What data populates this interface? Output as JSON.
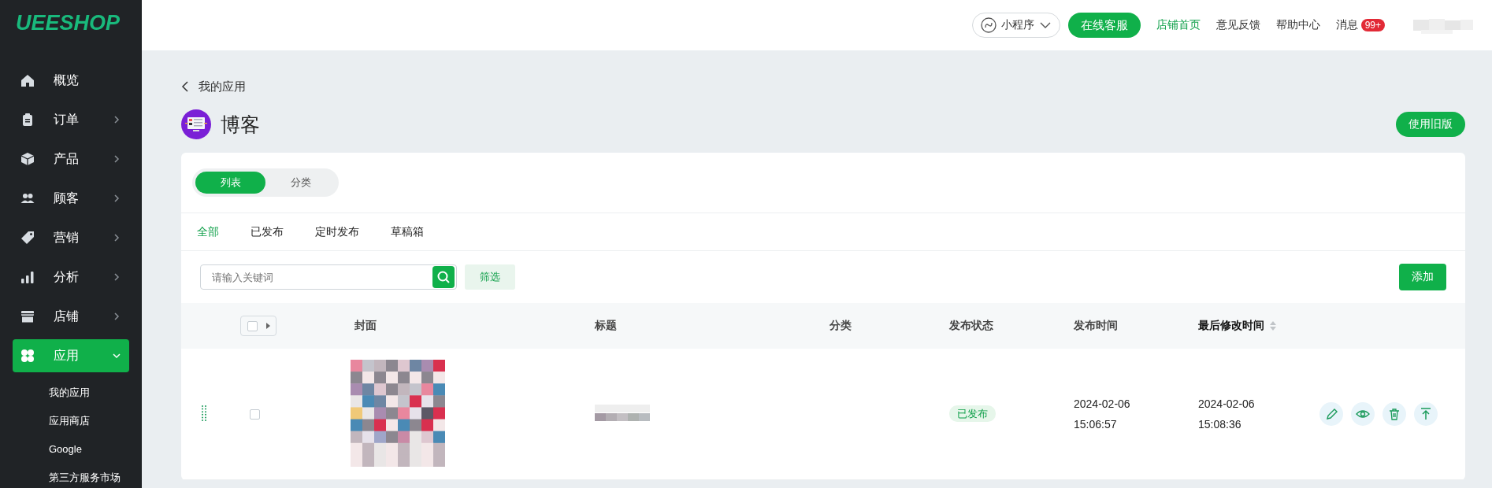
{
  "sidebar": {
    "logo": "UEESHOP",
    "items": [
      {
        "label": "概览",
        "has_arrow": false,
        "selected": false
      },
      {
        "label": "订单",
        "has_arrow": true,
        "selected": false,
        "expanded": false
      },
      {
        "label": "产品",
        "has_arrow": true,
        "selected": false,
        "expanded": false
      },
      {
        "label": "顾客",
        "has_arrow": true,
        "selected": false,
        "expanded": false
      },
      {
        "label": "营销",
        "has_arrow": true,
        "selected": false,
        "expanded": false
      },
      {
        "label": "分析",
        "has_arrow": true,
        "selected": false,
        "expanded": false
      },
      {
        "label": "店铺",
        "has_arrow": true,
        "selected": false,
        "expanded": false
      },
      {
        "label": "应用",
        "has_arrow": true,
        "selected": true,
        "expanded": true,
        "children": [
          "我的应用",
          "应用商店",
          "Google",
          "第三方服务市场"
        ]
      }
    ]
  },
  "topbar": {
    "mini_program": "小程序",
    "service_button": "在线客服",
    "links": [
      {
        "label": "店铺首页",
        "highlighted": true
      },
      {
        "label": "意见反馈",
        "highlighted": false
      },
      {
        "label": "帮助中心",
        "highlighted": false
      },
      {
        "label": "消息",
        "highlighted": false,
        "badge": "99+"
      }
    ]
  },
  "page": {
    "back_link": "我的应用",
    "title": "博客",
    "old_version_button": "使用旧版",
    "view_toggle": [
      {
        "label": "列表",
        "selected": true
      },
      {
        "label": "分类",
        "selected": false
      }
    ],
    "tabs": [
      {
        "label": "全部",
        "selected": true
      },
      {
        "label": "已发布",
        "selected": false
      },
      {
        "label": "定时发布",
        "selected": false
      },
      {
        "label": "草稿箱",
        "selected": false
      }
    ],
    "search": {
      "placeholder": "请输入关键词"
    },
    "filter_button": "筛选",
    "add_button": "添加",
    "table": {
      "columns": [
        {
          "label": "封面",
          "sortable": false,
          "bold": false
        },
        {
          "label": "标题",
          "sortable": false,
          "bold": false
        },
        {
          "label": "分类",
          "sortable": false,
          "bold": false
        },
        {
          "label": "发布状态",
          "sortable": false,
          "bold": false
        },
        {
          "label": "发布时间",
          "sortable": false,
          "bold": false
        },
        {
          "label": "最后修改时间",
          "sortable": true,
          "bold": true
        }
      ],
      "rows": [
        {
          "checked": false,
          "status": "已发布",
          "published_date": "2024-02-06",
          "published_time": "15:06:57",
          "modified_date": "2024-02-06",
          "modified_time": "15:08:36"
        }
      ]
    }
  }
}
